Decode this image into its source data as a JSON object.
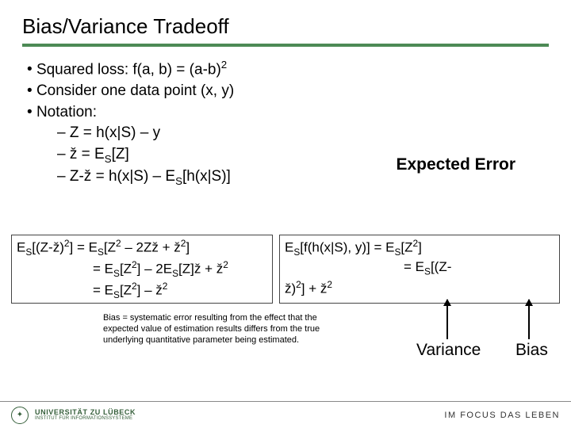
{
  "title": "Bias/Variance Tradeoff",
  "bul": {
    "b1": "Squared loss: f(a, b) = (a-b)",
    "b1_sup": "2",
    "b2": "Consider one data point (x, y)",
    "b3": "Notation:",
    "s1": "Z = h(x|S) – y",
    "s2a": "ž = E",
    "s2b": "[Z]",
    "s3a": "Z-ž = h(x|S) – E",
    "s3b": "[h(x|S)]"
  },
  "expected": "Expected Error",
  "ml": {
    "l1a": "E",
    "l1b": "[(Z-ž)",
    "l1c": "] = E",
    "l1d": "[Z",
    "l1e": " – 2Zž + ž",
    "l1f": "]",
    "l2a": "= E",
    "l2b": "[Z",
    "l2c": "] – 2E",
    "l2d": "[Z]ž + ž",
    "l3a": "= E",
    "l3b": "[Z",
    "l3c": "] – ž"
  },
  "mr": {
    "l1a": "E",
    "l1b": "[f(h(x|S), y)] = E",
    "l1c": "[Z",
    "l1d": "]",
    "l2a": "= E",
    "l2b": "[(Z-",
    "l3a": "ž)",
    "l3b": "] + ž"
  },
  "bias_def": "Bias = systematic error resulting from the effect that the expected value of estimation results differs from the true underlying quantitative parameter being estimated.",
  "variance_label": "Variance",
  "bias_label": "Bias",
  "sup2": "2",
  "subS": "S",
  "footer": {
    "uni_name": "UNIVERSITÄT ZU LÜBECK",
    "uni_sub": "INSTITUT FÜR INFORMATIONSSYSTEME",
    "motto": "IM FOCUS DAS LEBEN"
  }
}
